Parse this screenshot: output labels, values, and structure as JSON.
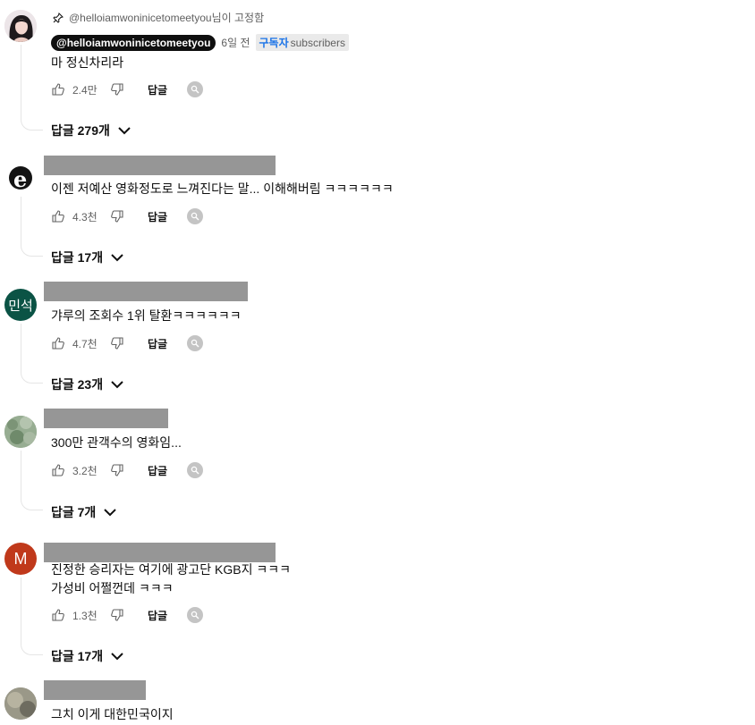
{
  "pinned": {
    "text": "@helloiamwoninicetomeetyou님이 고정함"
  },
  "comments": [
    {
      "author": "@helloiamwoninicetomeetyou",
      "time": "6일 전",
      "subscriber_badge": {
        "strong": "구독자",
        "rest": "subscribers"
      },
      "text": "마 정신차리라",
      "likes": "2.4만",
      "reply_label": "답글",
      "replies_label": "답글 279개"
    },
    {
      "avatar_letter": "e",
      "text": "이젠 저예산 영화정도로 느껴진다는 말... 이해해버림 ㅋㅋㅋㅋㅋㅋ",
      "likes": "4.3천",
      "reply_label": "답글",
      "replies_label": "답글 17개"
    },
    {
      "avatar_letter": "민석",
      "text": "갸루의 조회수 1위 탈환ㅋㅋㅋㅋㅋㅋ",
      "likes": "4.7천",
      "reply_label": "답글",
      "replies_label": "답글 23개"
    },
    {
      "text": "300만 관객수의 영화임...",
      "likes": "3.2천",
      "reply_label": "답글",
      "replies_label": "답글 7개"
    },
    {
      "avatar_letter": "M",
      "text_line1": "진정한 승리자는 여기에 광고단 KGB지 ㅋㅋㅋ",
      "text_line2": "가성비 어쩔껀데 ㅋㅋㅋ",
      "likes": "1.3천",
      "reply_label": "답글",
      "replies_label": "답글 17개"
    },
    {
      "text": "그치 이게 대한민국이지"
    }
  ],
  "colors": {
    "avatar_2": "#ffffff",
    "avatar_3": "#0b5345",
    "avatar_5": "#c0391b",
    "redaction": "#969696"
  }
}
